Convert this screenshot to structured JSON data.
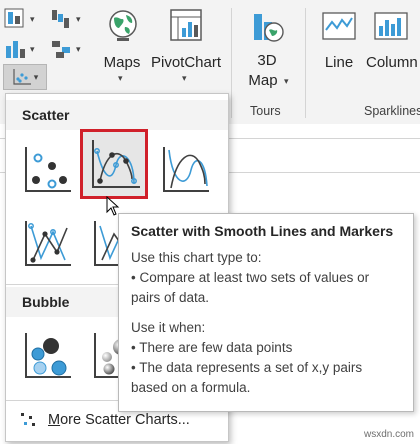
{
  "ribbon": {
    "buttons": {
      "maps": "Maps",
      "pivotchart": "PivotChart",
      "map3d_line1": "3D",
      "map3d_line2": "Map",
      "line": "Line",
      "column": "Column"
    },
    "groups": {
      "tours": "Tours",
      "sparklines": "Sparklines"
    }
  },
  "dropdown": {
    "scatter_header": "Scatter",
    "bubble_header": "Bubble",
    "more_prefix": "M",
    "more_rest": "ore Scatter Charts...",
    "selected_item": "Scatter with Smooth Lines and Markers"
  },
  "tooltip": {
    "title": "Scatter with Smooth Lines and Markers",
    "use_intro": "Use this chart type to:",
    "use_1a": "• Compare at least two sets of values or",
    "use_1b": "pairs of data.",
    "when_intro": "Use it when:",
    "when_1": "• There are few data points",
    "when_2a": "• The data represents a set of x,y pairs",
    "when_2b": "based on a formula."
  },
  "watermark": "wsxdn.com",
  "colors": {
    "accent_blue": "#3d9bd6",
    "selection_red": "#d0202a",
    "dark_gray": "#404040"
  }
}
